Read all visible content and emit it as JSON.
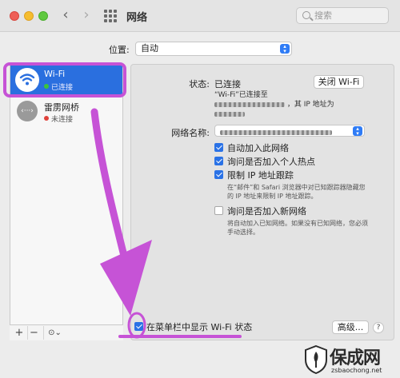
{
  "window": {
    "title": "网络",
    "search_placeholder": "搜索"
  },
  "location": {
    "label": "位置:",
    "value": "自动"
  },
  "sidebar": {
    "items": [
      {
        "name": "Wi-Fi",
        "status": "已连接",
        "status_color": "#3bc43b",
        "icon": "wifi-icon"
      },
      {
        "name": "雷雳网桥",
        "status": "未连接",
        "status_color": "#e0413a",
        "icon": "thunderbolt-bridge-icon"
      }
    ],
    "add": "+",
    "remove": "−",
    "action": "⊙⌄"
  },
  "detail": {
    "status_label": "状态:",
    "status_value": "已连接",
    "turn_off_label": "关闭 Wi-Fi",
    "connected_line_prefix": "“Wi-Fi”已连接至",
    "connected_line_mid": "，其 IP 地址为",
    "network_name_label": "网络名称:",
    "options": [
      {
        "label": "自动加入此网络",
        "checked": true
      },
      {
        "label": "询问是否加入个人热点",
        "checked": true
      },
      {
        "label": "限制 IP 地址跟踪",
        "checked": true
      }
    ],
    "limit_ip_desc": "在“邮件”和 Safari 浏览器中对已知跟踪器隐藏您的 IP 地址来限制 IP 地址跟踪。",
    "ask_new_label": "询问是否加入新网络",
    "ask_new_checked": false,
    "ask_new_desc": "将自动加入已知网络。如果没有已知网络，您必须手动选择。",
    "show_in_menubar_label": "在菜单栏中显示 Wi-Fi 状态",
    "show_in_menubar_checked": true,
    "advanced_label": "高级...",
    "help_label": "?"
  },
  "watermark": {
    "title": "保成网",
    "url": "zsbaochong.net"
  },
  "colors": {
    "accent": "#2a6fdf",
    "highlight": "#c653d6"
  }
}
